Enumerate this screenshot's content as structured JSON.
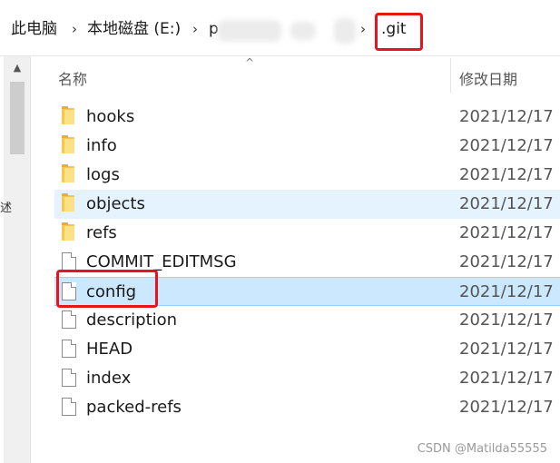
{
  "breadcrumb": {
    "items": [
      "此电脑",
      "本地磁盘 (E:)",
      "p",
      ".git"
    ],
    "separator": "›"
  },
  "column_header": {
    "sort_indicator": "^",
    "name": "名称",
    "date": "修改日期"
  },
  "files": [
    {
      "name": "hooks",
      "type": "folder",
      "date": "2021/12/17"
    },
    {
      "name": "info",
      "type": "folder",
      "date": "2021/12/17"
    },
    {
      "name": "logs",
      "type": "folder",
      "date": "2021/12/17"
    },
    {
      "name": "objects",
      "type": "folder",
      "date": "2021/12/17"
    },
    {
      "name": "refs",
      "type": "folder",
      "date": "2021/12/17"
    },
    {
      "name": "COMMIT_EDITMSG",
      "type": "file",
      "date": "2021/12/17"
    },
    {
      "name": "config",
      "type": "file",
      "date": "2021/12/17"
    },
    {
      "name": "description",
      "type": "file",
      "date": "2021/12/17"
    },
    {
      "name": "HEAD",
      "type": "file",
      "date": "2021/12/17"
    },
    {
      "name": "index",
      "type": "file",
      "date": "2021/12/17"
    },
    {
      "name": "packed-refs",
      "type": "file",
      "date": "2021/12/17"
    }
  ],
  "left_pane": {
    "cut_char": "述"
  },
  "watermark": "CSDN @Matilda55555",
  "colors": {
    "highlight": "#e8141c",
    "selected_row": "#cce8ff",
    "hover_row": "#e5f3ff",
    "folder": "#f7c948"
  }
}
